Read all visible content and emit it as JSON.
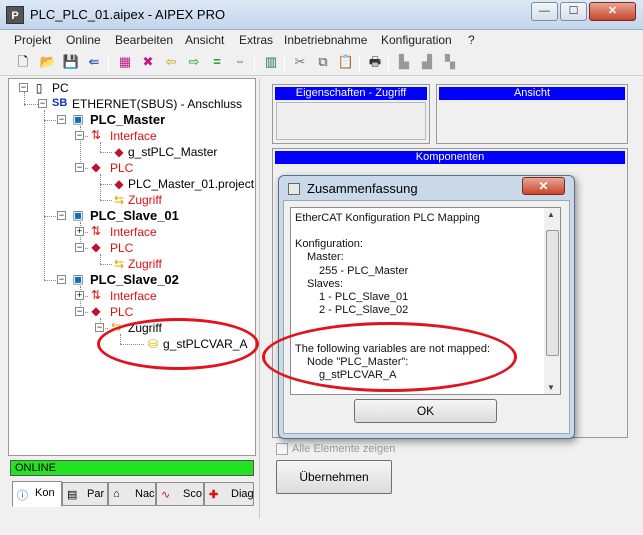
{
  "window": {
    "title": "PLC_PLC_01.aipex - AIPEX PRO",
    "app_icon_letter": "P",
    "minimize": "—",
    "maximize": "☐",
    "close": "✕"
  },
  "menu": [
    "Projekt",
    "Online",
    "Bearbeiten",
    "Ansicht",
    "Extras",
    "Inbetriebnahme",
    "Konfiguration",
    "?"
  ],
  "toolbar_icons": [
    "new-file-icon",
    "open-folder-icon",
    "save-icon",
    "import-icon",
    "plc-save-icon",
    "disconnect-icon",
    "arrow-left-icon",
    "arrow-right-icon",
    "equal-icon",
    "compare-m-icon",
    "calculator-icon",
    "cut-icon",
    "copy-icon",
    "paste-icon",
    "print-icon",
    "download-icon",
    "upload-icon",
    "transfer-icon"
  ],
  "tree": {
    "root": "PC",
    "bus_prefix": "SB",
    "bus": "ETHERNET(SBUS) - Anschluss",
    "master": "PLC_Master",
    "master_interface": "Interface",
    "master_var": "g_stPLC_Master",
    "master_plc": "PLC",
    "master_project": "PLC_Master_01.project",
    "master_access": "Zugriff",
    "slave1": "PLC_Slave_01",
    "slave1_interface": "Interface",
    "slave1_plc": "PLC",
    "slave1_access": "Zugriff",
    "slave2": "PLC_Slave_02",
    "slave2_interface": "Interface",
    "slave2_plc": "PLC",
    "slave2_access": "Zugriff",
    "slave2_var": "g_stPLCVAR_A"
  },
  "status": "ONLINE",
  "left_tabs": [
    "Kon",
    "Par",
    "Nac",
    "Sco",
    "Diag"
  ],
  "right": {
    "props_header": "Eigenschaften - Zugriff",
    "view_header": "Ansicht",
    "components_header": "Komponenten",
    "show_all": "Alle Elemente zeigen",
    "apply_button": "Übernehmen"
  },
  "dialog": {
    "title": "Zusammenfassung",
    "close": "✕",
    "lines": [
      "EtherCAT Konfiguration PLC Mapping",
      "",
      "Konfiguration:",
      "    Master:",
      "        255 - PLC_Master",
      "    Slaves:",
      "        1 - PLC_Slave_01",
      "        2 - PLC_Slave_02",
      "",
      "The following variables are not mapped:",
      "    Node \"PLC_Master\":",
      "        g_stPLCVAR_A"
    ],
    "ok": "OK"
  },
  "colors": {
    "header_blue": "#0000ff",
    "online_green": "#22e322",
    "annotation_red": "#e0141e",
    "tree_red_text": "#e01010"
  }
}
